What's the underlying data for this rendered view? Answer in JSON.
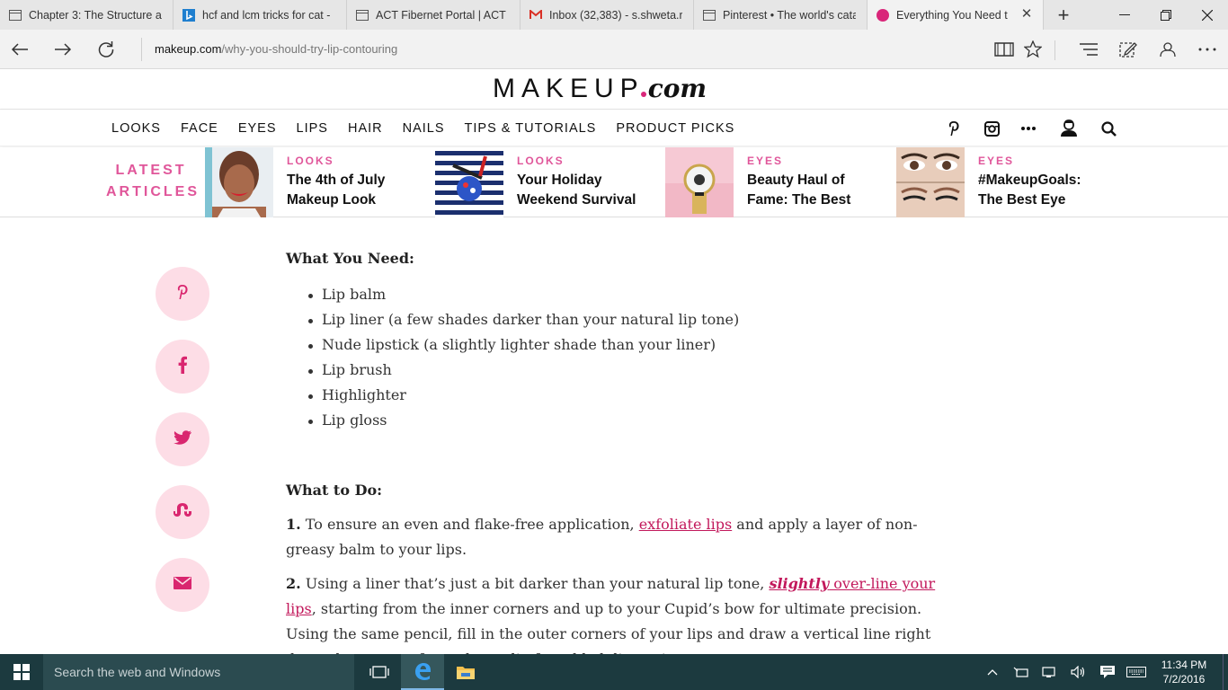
{
  "browser": {
    "tabs": [
      {
        "title": "Chapter 3: The Structure a",
        "icon": "page-icon"
      },
      {
        "title": "hcf and lcm tricks for cat -",
        "icon": "bing-icon"
      },
      {
        "title": "ACT Fibernet Portal | ACT F",
        "icon": "page-icon"
      },
      {
        "title": "Inbox (32,383) - s.shweta.r",
        "icon": "gmail-icon"
      },
      {
        "title": "Pinterest • The world's cata",
        "icon": "page-icon"
      },
      {
        "title": "Everything You Need t",
        "icon": "makeup-dot-icon"
      }
    ],
    "url_domain": "makeup.com",
    "url_path": "/why-you-should-try-lip-contouring"
  },
  "site": {
    "logo_main": "MAKEUP",
    "logo_com": "com",
    "nav": [
      "LOOKS",
      "FACE",
      "EYES",
      "LIPS",
      "HAIR",
      "NAILS",
      "TIPS & TUTORIALS",
      "PRODUCT PICKS"
    ],
    "latest_label_1": "LATEST",
    "latest_label_2": "ARTICLES",
    "articles": [
      {
        "category": "LOOKS",
        "title_1": "The 4th of July",
        "title_2": "Makeup Look"
      },
      {
        "category": "LOOKS",
        "title_1": "Your Holiday",
        "title_2": "Weekend Survival"
      },
      {
        "category": "EYES",
        "title_1": "Beauty Haul of",
        "title_2": "Fame: The Best"
      },
      {
        "category": "EYES",
        "title_1": "#MakeupGoals:",
        "title_2": "The Best Eye"
      }
    ]
  },
  "share": [
    "pinterest-icon",
    "facebook-icon",
    "twitter-icon",
    "stumbleupon-icon",
    "email-icon"
  ],
  "article": {
    "need_heading": "What You Need:",
    "need_items": [
      "Lip balm",
      "Lip liner (a few shades darker than your natural lip tone)",
      "Nude lipstick (a slightly lighter shade than your liner)",
      "Lip brush",
      "Highlighter",
      "Lip gloss"
    ],
    "do_heading": "What to Do:",
    "step1_num": "1.",
    "step1_pre": "To ensure an even and flake-free application, ",
    "step1_link": "exfoliate lips",
    "step1_post": " and apply a layer of non-greasy balm to your lips.",
    "step2_num": "2.",
    "step2_pre": "Using a liner that’s just a bit darker than your natural lip tone, ",
    "step2_link_em": "slightly",
    "step2_link": " over-line your lips",
    "step2_post": ", starting from the inner corners and up to your Cupid’s bow for ultimate precision. Using the same pencil, fill in the outer corners of your lips and draw a vertical line right down the center of your lower lip for added dimension."
  },
  "taskbar": {
    "search_placeholder": "Search the web and Windows",
    "time": "11:34 PM",
    "date": "7/2/2016"
  },
  "colors": {
    "accent_pink": "#e0569a",
    "link": "#c2185b",
    "share_bg": "#fddde6",
    "taskbar": "#1c3a3f"
  }
}
